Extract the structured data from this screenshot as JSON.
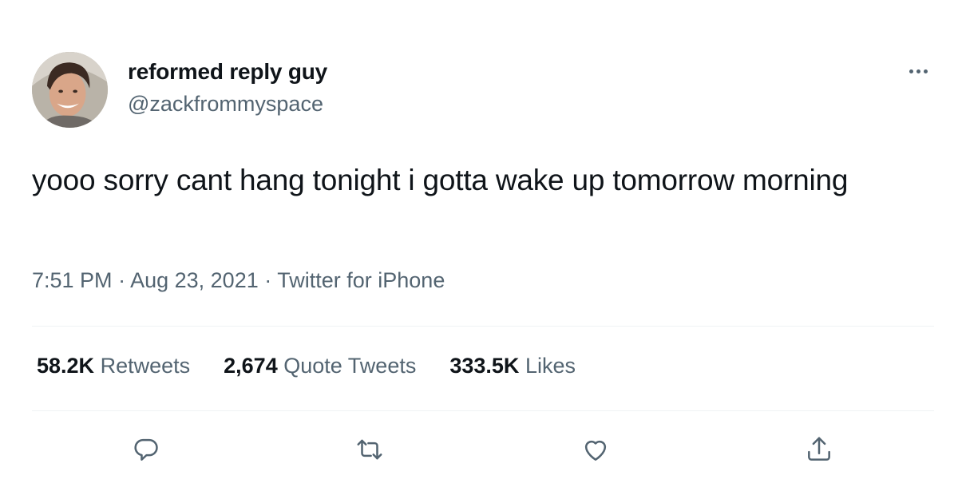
{
  "user": {
    "display_name": "reformed reply guy",
    "handle": "@zackfrommyspace"
  },
  "tweet": {
    "text": "yooo sorry cant hang tonight i gotta wake up tomorrow morning",
    "time": "7:51 PM",
    "date": "Aug 23, 2021",
    "source": "Twitter for iPhone",
    "separator": " · "
  },
  "stats": {
    "retweets": {
      "count": "58.2K",
      "label": "Retweets"
    },
    "quote_tweets": {
      "count": "2,674",
      "label": "Quote Tweets"
    },
    "likes": {
      "count": "333.5K",
      "label": "Likes"
    }
  },
  "icons": {
    "more": "more-horizontal-icon",
    "reply": "reply-icon",
    "retweet": "retweet-icon",
    "like": "heart-icon",
    "share": "share-icon"
  },
  "colors": {
    "text_primary": "#0f1419",
    "text_secondary": "#536471",
    "divider": "#eff3f4"
  }
}
